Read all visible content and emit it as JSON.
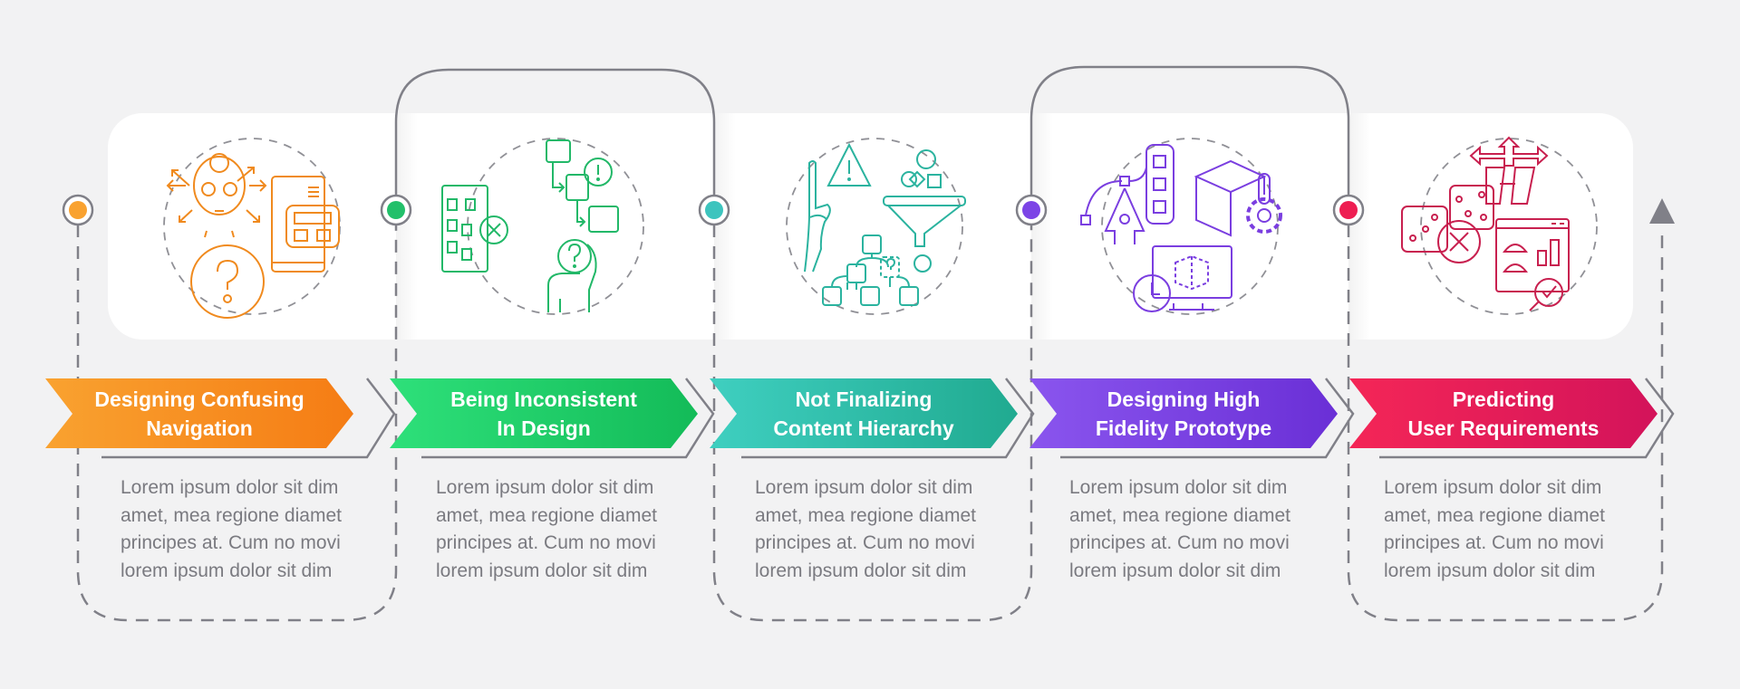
{
  "infographic": {
    "steps": [
      {
        "title_line1": "Designing Confusing",
        "title_line2": "Navigation",
        "color_start": "#f9a230",
        "color_end": "#f57c14",
        "dot_color": "#f9a230",
        "icon": "confused-person-navigation-icon",
        "description": [
          "Lorem ipsum dolor sit dim",
          "amet, mea regione diamet",
          "principes at. Cum no movi",
          "lorem ipsum dolor sit dim"
        ]
      },
      {
        "title_line1": "Being Inconsistent",
        "title_line2": "In Design",
        "color_start": "#2ee07a",
        "color_end": "#13bb58",
        "dot_color": "#22c06a",
        "icon": "inconsistent-flowchart-icon",
        "description": [
          "Lorem ipsum dolor sit dim",
          "amet, mea regione diamet",
          "principes at. Cum no movi",
          "lorem ipsum dolor sit dim"
        ]
      },
      {
        "title_line1": "Not Finalizing",
        "title_line2": "Content Hierarchy",
        "color_start": "#3fcfc0",
        "color_end": "#20aa90",
        "dot_color": "#3dc4be",
        "icon": "content-hierarchy-funnel-icon",
        "description": [
          "Lorem ipsum dolor sit dim",
          "amet, mea regione diamet",
          "principes at. Cum no movi",
          "lorem ipsum dolor sit dim"
        ]
      },
      {
        "title_line1": "Designing High",
        "title_line2": "Fidelity Prototype",
        "color_start": "#8a55ee",
        "color_end": "#6a2fd6",
        "dot_color": "#7c44e6",
        "icon": "high-fidelity-prototype-icon",
        "description": [
          "Lorem ipsum dolor sit dim",
          "amet, mea regione diamet",
          "principes at. Cum no movi",
          "lorem ipsum dolor sit dim"
        ]
      },
      {
        "title_line1": "Predicting",
        "title_line2": "User Requirements",
        "color_start": "#f42657",
        "color_end": "#d3135a",
        "dot_color": "#ee1e52",
        "icon": "predicting-requirements-icon",
        "description": [
          "Lorem ipsum dolor sit dim",
          "amet, mea regione diamet",
          "principes at. Cum no movi",
          "lorem ipsum dolor sit dim"
        ]
      }
    ],
    "connector_color": "#808088",
    "end_marker": "up-arrow-icon"
  }
}
